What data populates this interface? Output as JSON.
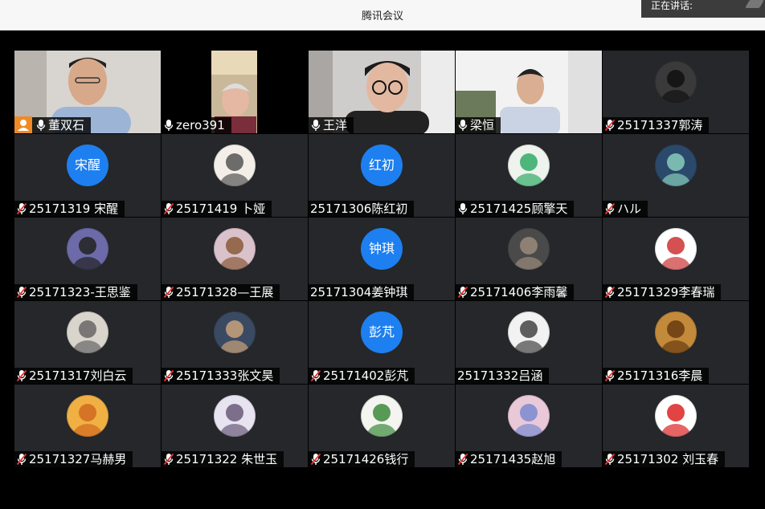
{
  "window": {
    "title": "腾讯会议"
  },
  "speaking": {
    "label": "正在讲话:"
  },
  "participants": [
    {
      "name": "董双石",
      "kind": "video",
      "mic": "on",
      "host": true,
      "scene": "v1"
    },
    {
      "name": "zero391",
      "kind": "video",
      "mic": "on",
      "scene": "v2"
    },
    {
      "name": "王洋",
      "kind": "video",
      "mic": "on",
      "scene": "v3"
    },
    {
      "name": "梁恒",
      "kind": "video",
      "mic": "on",
      "scene": "v4"
    },
    {
      "name": "25171337郭涛",
      "kind": "img",
      "mic": "muted",
      "bg": [
        "#3a3a3a",
        "#111"
      ]
    },
    {
      "name": "25171319  宋醒",
      "kind": "text",
      "avatar_text": "宋醒",
      "mic": "muted"
    },
    {
      "name": "25171419 卜娅",
      "kind": "img",
      "mic": "muted",
      "bg": [
        "#f3efe8",
        "#555"
      ]
    },
    {
      "name": "25171306陈红初",
      "kind": "text",
      "avatar_text": "红初",
      "mic": "none"
    },
    {
      "name": "25171425顾擎天",
      "kind": "img",
      "mic": "on",
      "bg": [
        "#eef3ee",
        "#3a6"
      ]
    },
    {
      "name": "ハル",
      "kind": "img",
      "mic": "muted",
      "bg": [
        "#2b4a6b",
        "#8cb"
      ]
    },
    {
      "name": "25171323-王思鉴",
      "kind": "img",
      "mic": "muted",
      "bg": [
        "#6c6aa8",
        "#222"
      ]
    },
    {
      "name": "25171328—王展",
      "kind": "img",
      "mic": "muted",
      "bg": [
        "#d9c2c9",
        "#8a5a3a"
      ]
    },
    {
      "name": "25171304姜钟琪",
      "kind": "text",
      "avatar_text": "钟琪",
      "mic": "none"
    },
    {
      "name": "25171406李雨馨",
      "kind": "img",
      "mic": "muted",
      "bg": [
        "#4a4a4a",
        "#9a8a7a"
      ]
    },
    {
      "name": "25171329李春瑞",
      "kind": "img",
      "mic": "muted",
      "bg": [
        "#ffffff",
        "#c33"
      ]
    },
    {
      "name": "25171317刘白云",
      "kind": "img",
      "mic": "muted",
      "bg": [
        "#d9d4cc",
        "#666"
      ]
    },
    {
      "name": "25171333张文昊",
      "kind": "img",
      "mic": "muted",
      "bg": [
        "#3b4a63",
        "#c9a27a"
      ]
    },
    {
      "name": "25171402彭芃",
      "kind": "text",
      "avatar_text": "彭芃",
      "mic": "muted"
    },
    {
      "name": "25171332吕涵",
      "kind": "img",
      "mic": "none",
      "bg": [
        "#f2f2f2",
        "#444"
      ]
    },
    {
      "name": "25171316李晨",
      "kind": "img",
      "mic": "muted",
      "bg": [
        "#c28a3a",
        "#6a3a10"
      ]
    },
    {
      "name": "25171327马赫男",
      "kind": "img",
      "mic": "muted",
      "bg": [
        "#f0b043",
        "#d06a20"
      ]
    },
    {
      "name": "25171322 朱世玉",
      "kind": "img",
      "mic": "muted",
      "bg": [
        "#e8e3f0",
        "#6a5a7a"
      ]
    },
    {
      "name": "25171426钱行",
      "kind": "img",
      "mic": "muted",
      "bg": [
        "#f4f4f0",
        "#3a8a3a"
      ]
    },
    {
      "name": "25171435赵旭",
      "kind": "img",
      "mic": "muted",
      "bg": [
        "#e9c8d8",
        "#7a8ad0"
      ]
    },
    {
      "name": " 25171302  刘玉春",
      "kind": "img",
      "mic": "muted",
      "bg": [
        "#ffffff",
        "#d22"
      ]
    }
  ],
  "colors": {
    "accent": "#1d7ff0",
    "host": "#f08a24",
    "muted_red": "#e33",
    "tile_bg": "#25272a"
  }
}
